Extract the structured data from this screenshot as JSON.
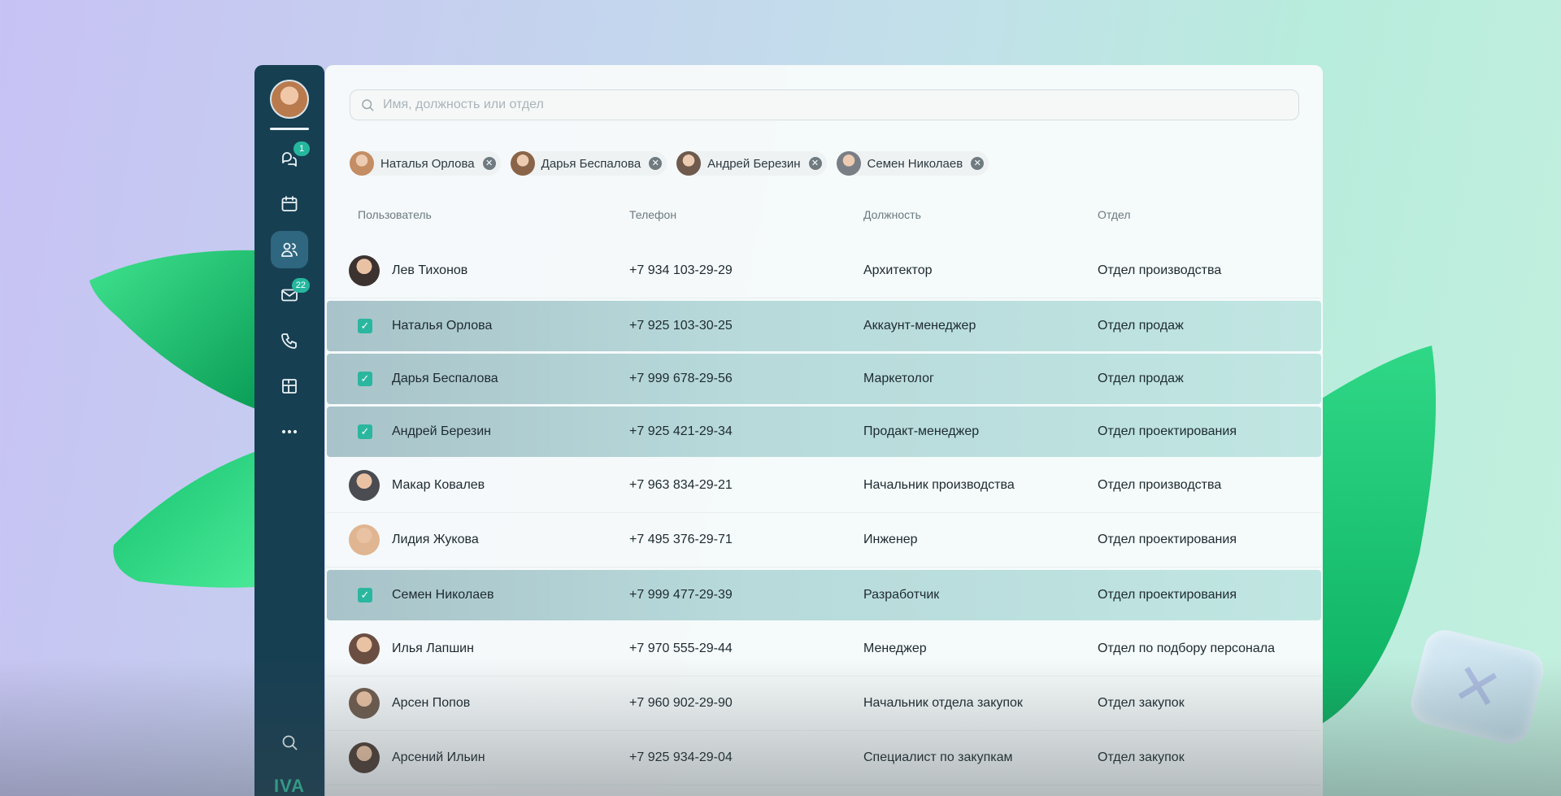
{
  "colors": {
    "sidebar": "#173f52",
    "accent": "#2bb79f",
    "selected_row": "#b7d9da"
  },
  "sidebar": {
    "items": [
      {
        "icon": "chat-bubbles-icon",
        "badge": "1"
      },
      {
        "icon": "calendar-icon",
        "badge": ""
      },
      {
        "icon": "contacts-icon",
        "badge": "",
        "active": true
      },
      {
        "icon": "mail-icon",
        "badge": "22"
      },
      {
        "icon": "phone-icon",
        "badge": ""
      },
      {
        "icon": "apps-grid-icon",
        "badge": ""
      },
      {
        "icon": "more-dots-icon",
        "badge": ""
      }
    ],
    "bottom": {
      "search_icon": "search-icon",
      "logo": "IVA"
    }
  },
  "search": {
    "placeholder": "Имя, должность или отдел"
  },
  "chips": [
    {
      "label": "Наталья Орлова",
      "avatar_color": "#c48d63"
    },
    {
      "label": "Дарья Беспалова",
      "avatar_color": "#8a6448"
    },
    {
      "label": "Андрей Березин",
      "avatar_color": "#6f5a4d"
    },
    {
      "label": "Семен Николаев",
      "avatar_color": "#7a7e85"
    }
  ],
  "table": {
    "headers": {
      "user": "Пользователь",
      "phone": "Телефон",
      "position": "Должность",
      "department": "Отдел"
    },
    "rows": [
      {
        "name": "Лев Тихонов",
        "phone": "+7 934 103-29-29",
        "position": "Архитектор",
        "department": "Отдел производства",
        "selected": false,
        "avatar_color": "#3c3330"
      },
      {
        "name": "Наталья Орлова",
        "phone": "+7 925 103-30-25",
        "position": "Аккаунт-менеджер",
        "department": "Отдел продаж",
        "selected": true,
        "avatar_color": ""
      },
      {
        "name": "Дарья Беспалова",
        "phone": "+7 999 678-29-56",
        "position": "Маркетолог",
        "department": "Отдел продаж",
        "selected": true,
        "avatar_color": ""
      },
      {
        "name": "Андрей Березин",
        "phone": "+7 925 421-29-34",
        "position": "Продакт-менеджер",
        "department": "Отдел проектирования",
        "selected": true,
        "avatar_color": ""
      },
      {
        "name": "Макар Ковалев",
        "phone": "+7 963 834-29-21",
        "position": "Начальник производства",
        "department": "Отдел производства",
        "selected": false,
        "avatar_color": "#4a4c52"
      },
      {
        "name": "Лидия Жукова",
        "phone": "+7 495 376-29-71",
        "position": "Инженер",
        "department": "Отдел проектирования",
        "selected": false,
        "avatar_color": "#e0b591"
      },
      {
        "name": "Семен Николаев",
        "phone": "+7 999 477-29-39",
        "position": "Разработчик",
        "department": "Отдел проектирования",
        "selected": true,
        "avatar_color": ""
      },
      {
        "name": "Илья Лапшин",
        "phone": "+7 970 555-29-44",
        "position": "Менеджер",
        "department": "Отдел по подбору персонала",
        "selected": false,
        "avatar_color": "#6b4e42"
      },
      {
        "name": "Арсен Попов",
        "phone": "+7 960 902-29-90",
        "position": "Начальник отдела закупок",
        "department": "Отдел закупок",
        "selected": false,
        "avatar_color": "#705d4f"
      },
      {
        "name": "Арсений Ильин",
        "phone": "+7 925 934-29-04",
        "position": "Специалист по закупкам",
        "department": "Отдел закупок",
        "selected": false,
        "avatar_color": "#4f3e36"
      }
    ]
  }
}
